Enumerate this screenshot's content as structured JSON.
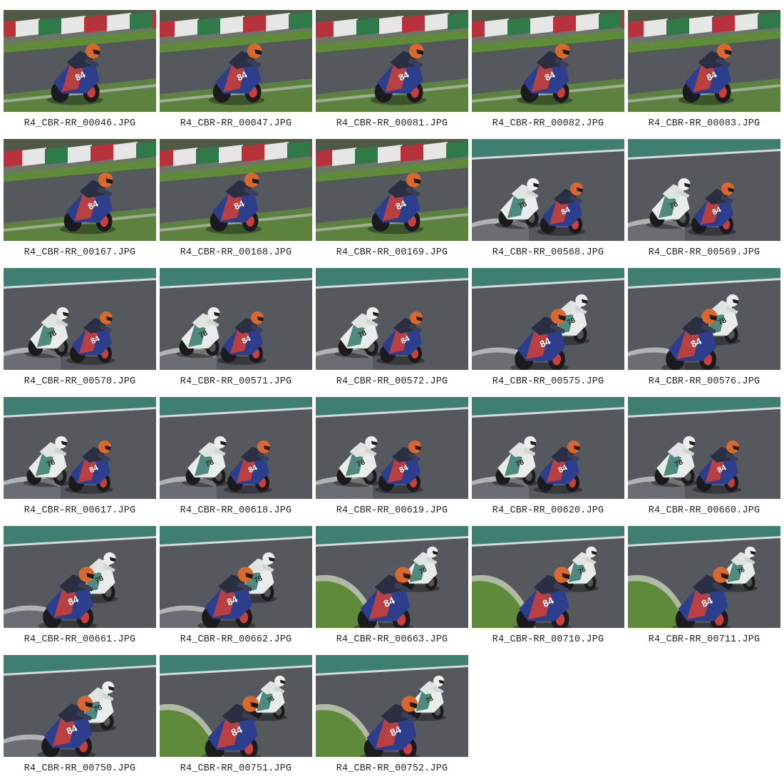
{
  "gallery": {
    "photos": [
      {
        "filename": "R4_CBR-RR_00046.JPG",
        "scene": "wall-solo"
      },
      {
        "filename": "R4_CBR-RR_00047.JPG",
        "scene": "wall-solo"
      },
      {
        "filename": "R4_CBR-RR_00081.JPG",
        "scene": "wall-solo"
      },
      {
        "filename": "R4_CBR-RR_00082.JPG",
        "scene": "wall-solo"
      },
      {
        "filename": "R4_CBR-RR_00083.JPG",
        "scene": "wall-solo"
      },
      {
        "filename": "R4_CBR-RR_00167.JPG",
        "scene": "wall-solo"
      },
      {
        "filename": "R4_CBR-RR_00168.JPG",
        "scene": "wall-solo"
      },
      {
        "filename": "R4_CBR-RR_00169.JPG",
        "scene": "wall-solo"
      },
      {
        "filename": "R4_CBR-RR_00568.JPG",
        "scene": "duo-far"
      },
      {
        "filename": "R4_CBR-RR_00569.JPG",
        "scene": "duo-far"
      },
      {
        "filename": "R4_CBR-RR_00570.JPG",
        "scene": "duo-far"
      },
      {
        "filename": "R4_CBR-RR_00571.JPG",
        "scene": "duo-far"
      },
      {
        "filename": "R4_CBR-RR_00572.JPG",
        "scene": "duo-far"
      },
      {
        "filename": "R4_CBR-RR_00575.JPG",
        "scene": "duo-near"
      },
      {
        "filename": "R4_CBR-RR_00576.JPG",
        "scene": "duo-near"
      },
      {
        "filename": "R4_CBR-RR_00617.JPG",
        "scene": "duo-far"
      },
      {
        "filename": "R4_CBR-RR_00618.JPG",
        "scene": "duo-far"
      },
      {
        "filename": "R4_CBR-RR_00619.JPG",
        "scene": "duo-far"
      },
      {
        "filename": "R4_CBR-RR_00620.JPG",
        "scene": "duo-far"
      },
      {
        "filename": "R4_CBR-RR_00660.JPG",
        "scene": "duo-far"
      },
      {
        "filename": "R4_CBR-RR_00661.JPG",
        "scene": "duo-near"
      },
      {
        "filename": "R4_CBR-RR_00662.JPG",
        "scene": "duo-near"
      },
      {
        "filename": "R4_CBR-RR_00663.JPG",
        "scene": "duo-grass"
      },
      {
        "filename": "R4_CBR-RR_00710.JPG",
        "scene": "duo-grass"
      },
      {
        "filename": "R4_CBR-RR_00711.JPG",
        "scene": "duo-grass"
      },
      {
        "filename": "R4_CBR-RR_00750.JPG",
        "scene": "duo-near"
      },
      {
        "filename": "R4_CBR-RR_00751.JPG",
        "scene": "duo-grass"
      },
      {
        "filename": "R4_CBR-RR_00752.JPG",
        "scene": "duo-grass"
      }
    ],
    "rider_number": "84",
    "second_rider_number": "78",
    "colors": {
      "asphalt": "#55585d",
      "grass": "#5f8a3a",
      "wall_red": "#b8323c",
      "wall_white": "#e6e6e6",
      "wall_green": "#2f7a48",
      "teal_barrier": "#3f7f72",
      "bike_blue": "#2d3f8c",
      "bike_red": "#c8403a",
      "helmet_orange": "#d8682c",
      "helmet_white": "#eeeeee",
      "bike_white": "#e8ecea"
    }
  }
}
